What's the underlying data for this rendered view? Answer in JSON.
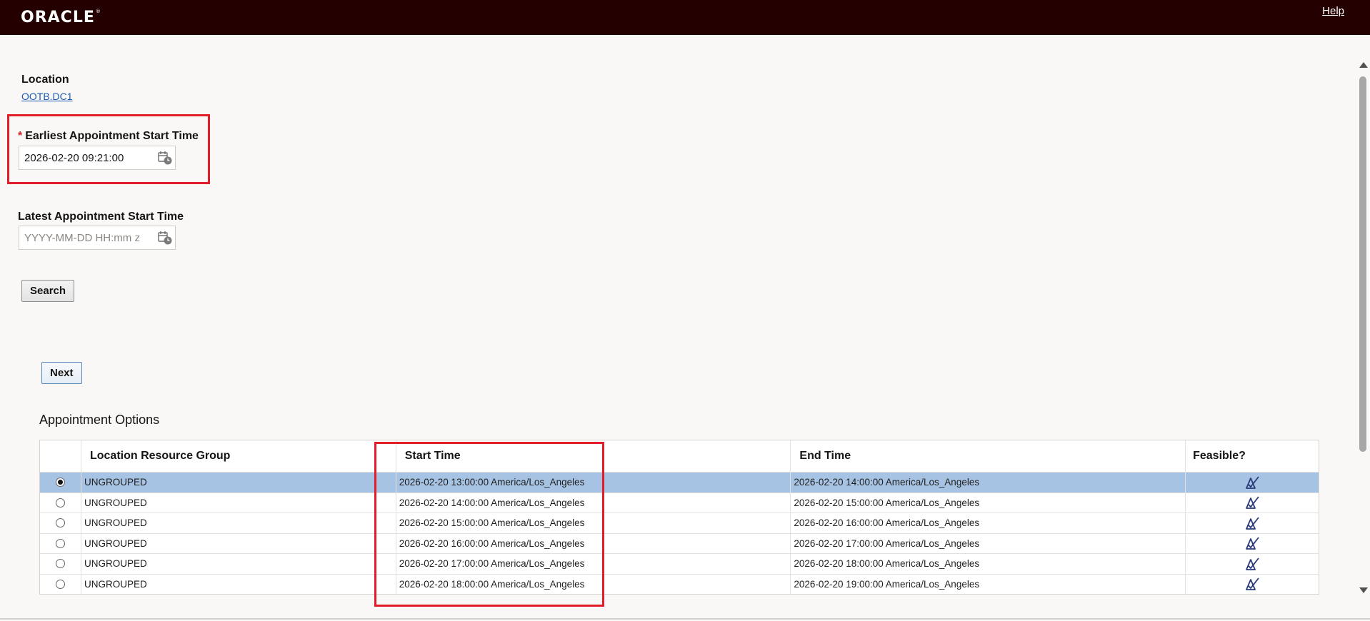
{
  "header": {
    "logo_text": "ORACLE",
    "help_label": "Help"
  },
  "location": {
    "label": "Location",
    "value": "OOTB.DC1"
  },
  "earliest": {
    "label": "Earliest Appointment Start Time",
    "required_marker": "*",
    "value": "2026-02-20 09:21:00"
  },
  "latest": {
    "label": "Latest Appointment Start Time",
    "placeholder": "YYYY-MM-DD HH:mm z",
    "value": ""
  },
  "buttons": {
    "search_label": "Search",
    "next_label": "Next"
  },
  "options": {
    "title": "Appointment Options",
    "columns": [
      "",
      "Location Resource Group",
      "Start Time",
      "End Time",
      "Feasible?"
    ],
    "selected_index": 0,
    "feasible_icon": "feasible-check-icon",
    "rows": [
      {
        "group": "UNGROUPED",
        "start": "2026-02-20 13:00:00 America/Los_Angeles",
        "end": "2026-02-20 14:00:00 America/Los_Angeles"
      },
      {
        "group": "UNGROUPED",
        "start": "2026-02-20 14:00:00 America/Los_Angeles",
        "end": "2026-02-20 15:00:00 America/Los_Angeles"
      },
      {
        "group": "UNGROUPED",
        "start": "2026-02-20 15:00:00 America/Los_Angeles",
        "end": "2026-02-20 16:00:00 America/Los_Angeles"
      },
      {
        "group": "UNGROUPED",
        "start": "2026-02-20 16:00:00 America/Los_Angeles",
        "end": "2026-02-20 17:00:00 America/Los_Angeles"
      },
      {
        "group": "UNGROUPED",
        "start": "2026-02-20 17:00:00 America/Los_Angeles",
        "end": "2026-02-20 18:00:00 America/Los_Angeles"
      },
      {
        "group": "UNGROUPED",
        "start": "2026-02-20 18:00:00 America/Los_Angeles",
        "end": "2026-02-20 19:00:00 America/Los_Angeles"
      }
    ]
  },
  "colors": {
    "topbar": "#250000",
    "selected_row": "#a6c3e3",
    "highlight_box": "#e11d2a",
    "link": "#1c5bb5"
  }
}
